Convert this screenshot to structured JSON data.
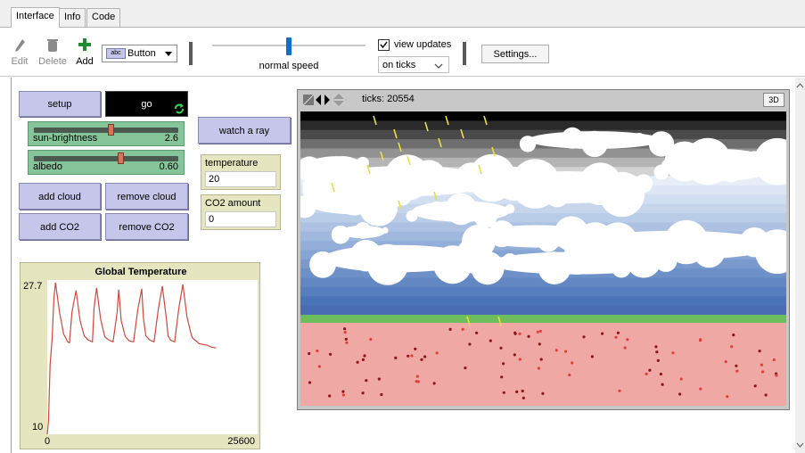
{
  "tabs": [
    {
      "label": "Interface",
      "active": true
    },
    {
      "label": "Info",
      "active": false
    },
    {
      "label": "Code",
      "active": false
    }
  ],
  "toolbar": {
    "edit_label": "Edit",
    "delete_label": "Delete",
    "add_label": "Add",
    "widget_icon_text": "abc",
    "widget_type": "Button",
    "speed_label": "normal speed",
    "speed_fraction": 0.5,
    "view_updates_label": "view updates",
    "view_updates_checked": true,
    "update_mode": "on ticks",
    "settings_label": "Settings..."
  },
  "buttons": {
    "setup": "setup",
    "go": "go",
    "watch_ray": "watch a ray",
    "add_cloud": "add cloud",
    "remove_cloud": "remove cloud",
    "add_co2": "add CO2",
    "remove_co2": "remove CO2"
  },
  "sliders": {
    "sun_brightness": {
      "name": "sun-brightness",
      "value": "2.6",
      "fraction": 0.53
    },
    "albedo": {
      "name": "albedo",
      "value": "0.60",
      "fraction": 0.6
    }
  },
  "monitors": {
    "temperature": {
      "label": "temperature",
      "value": "20"
    },
    "co2": {
      "label": "CO2 amount",
      "value": "0"
    }
  },
  "view": {
    "ticks_text": "ticks: 20554",
    "three_d_label": "3D"
  },
  "colors": {
    "button": "#c6c6ea",
    "slider": "#86c49a",
    "monitor": "#e5e5bf",
    "plot_line": "#d0483a",
    "ground": "#f0a8a4",
    "grass": "#6cbd5c",
    "ray": "#e8e040"
  },
  "chart_data": {
    "type": "line",
    "title": "Global Temperature",
    "xlabel": "",
    "ylabel": "",
    "xlim": [
      0,
      25600
    ],
    "ylim": [
      10,
      27.7
    ],
    "x_tick_labels": [
      "0",
      "25600"
    ],
    "y_tick_labels": [
      "10",
      "27.7"
    ],
    "series": [
      {
        "color": "#d0483a",
        "x": [
          0,
          150,
          350,
          600,
          800,
          1000,
          1500,
          2000,
          2500,
          2700,
          3000,
          3500,
          4000,
          4500,
          5000,
          5500,
          5700,
          6000,
          6500,
          7000,
          7500,
          8000,
          8500,
          8700,
          9000,
          9500,
          10000,
          10500,
          11000,
          11500,
          11700,
          12000,
          12500,
          13000,
          13500,
          14000,
          14500,
          14700,
          15000,
          15500,
          16000,
          16500,
          17000,
          17500,
          17700,
          18000,
          18500,
          19000,
          19500,
          20000,
          20554
        ],
        "y": [
          10,
          11.5,
          18,
          21,
          25.5,
          27.4,
          24,
          21.5,
          20.6,
          20.5,
          24,
          26.5,
          23,
          21.3,
          20.8,
          20.6,
          24.5,
          26.8,
          23.2,
          21.2,
          20.8,
          20.6,
          24,
          26.6,
          23,
          21.2,
          20.7,
          20.6,
          24.2,
          26.7,
          23.3,
          21.3,
          20.8,
          20.6,
          24.3,
          27,
          23.2,
          21.3,
          20.8,
          20.6,
          24.4,
          27.2,
          23.5,
          21.5,
          21,
          20.8,
          20.4,
          20.3,
          20.2,
          20.0,
          19.9
        ]
      }
    ]
  }
}
